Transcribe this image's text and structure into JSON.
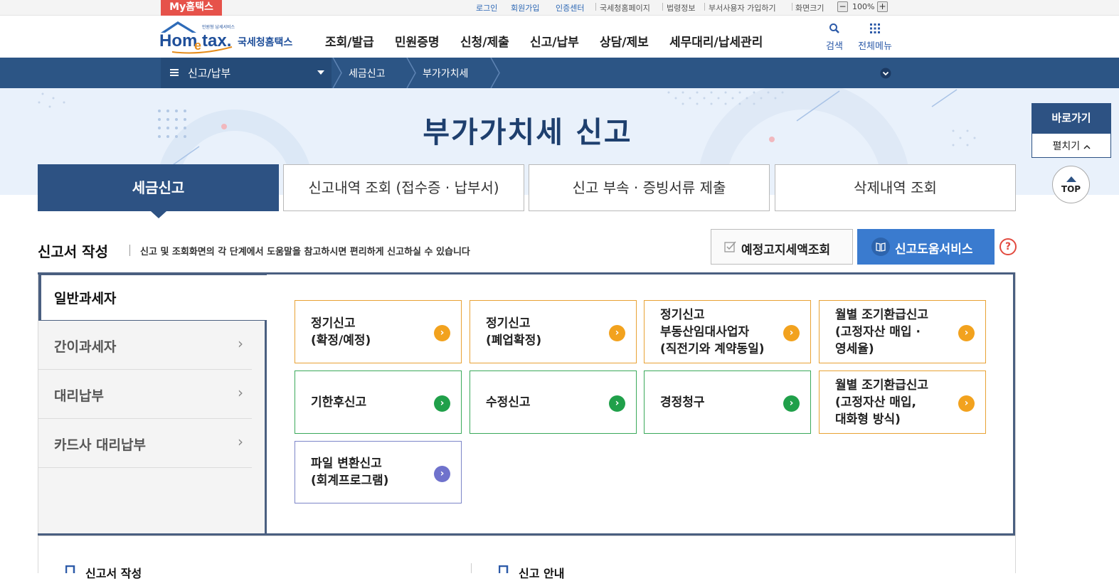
{
  "util": {
    "my_hometax": "My홈택스",
    "login": "로그인",
    "signup": "회원가입",
    "cert_center": "인증센터",
    "nts_page": "국세청홈페이지",
    "law_info": "법령정보",
    "dept_user_signup": "부서사용자 가입하기",
    "screen_size": "화면크기",
    "zoom_minus": "−",
    "zoom_level": "100%",
    "zoom_plus": "+"
  },
  "header": {
    "logo_tagline": "민원형 납세서비스",
    "logo_name": "국세청홈택스",
    "logo_hom": "Hom",
    "logo_e": "e",
    "logo_tax": "tax.",
    "nav": [
      "조회/발급",
      "민원증명",
      "신청/제출",
      "신고/납부",
      "상담/제보",
      "세무대리/납세관리"
    ],
    "search_label": "검색",
    "all_menu_label": "전체메뉴"
  },
  "breadcrumb": {
    "menu": "신고/납부",
    "level1": "세금신고",
    "level2": "부가가치세"
  },
  "page_title": "부가가치세  신고",
  "tabs": [
    "세금신고",
    "신고내역 조회 (접수증 · 납부서)",
    "신고 부속 · 증빙서류 제출",
    "삭제내역 조회"
  ],
  "quick": {
    "title": "바로가기",
    "expand": "펼치기",
    "top": "TOP"
  },
  "section": {
    "title": "신고서 작성",
    "desc": "신고 및 조회화면의 각 단계에서 도움말을 참고하시면 편리하게 신고하실 수 있습니다",
    "estimate_btn": "예정고지세액조회",
    "help_btn": "신고도움서비스",
    "help_q": "?"
  },
  "side_menu": {
    "active": "일반과세자",
    "items": [
      "간이과세자",
      "대리납부",
      "카드사 대리납부"
    ]
  },
  "cards": [
    {
      "lines": [
        "정기신고",
        "(확정/예정)"
      ],
      "color": "#f2a21e"
    },
    {
      "lines": [
        "정기신고",
        "(폐업확정)"
      ],
      "color": "#f2a21e"
    },
    {
      "lines": [
        "정기신고",
        "부동산임대사업자",
        "(직전기와 계약동일)"
      ],
      "color": "#f2a21e"
    },
    {
      "lines": [
        "월별 조기환급신고",
        "(고정자산 매입 ·",
        "영세율)"
      ],
      "color": "#f2a21e"
    },
    {
      "lines": [
        "기한후신고"
      ],
      "color": "#20a04a"
    },
    {
      "lines": [
        "수정신고"
      ],
      "color": "#20a04a"
    },
    {
      "lines": [
        "경정청구"
      ],
      "color": "#20a04a"
    },
    {
      "lines": [
        "월별 조기환급신고",
        "(고정자산 매입,",
        "대화형 방식)"
      ],
      "color": "#f2a21e"
    },
    {
      "lines": [
        "파일 변환신고",
        "(회계프로그램)"
      ],
      "color": "#6f72cc"
    }
  ],
  "bottom": {
    "left_title": "신고서 작성",
    "right_title": "신고 안내"
  },
  "icons": {
    "card_arrow": "›",
    "side_chevron": "›"
  }
}
